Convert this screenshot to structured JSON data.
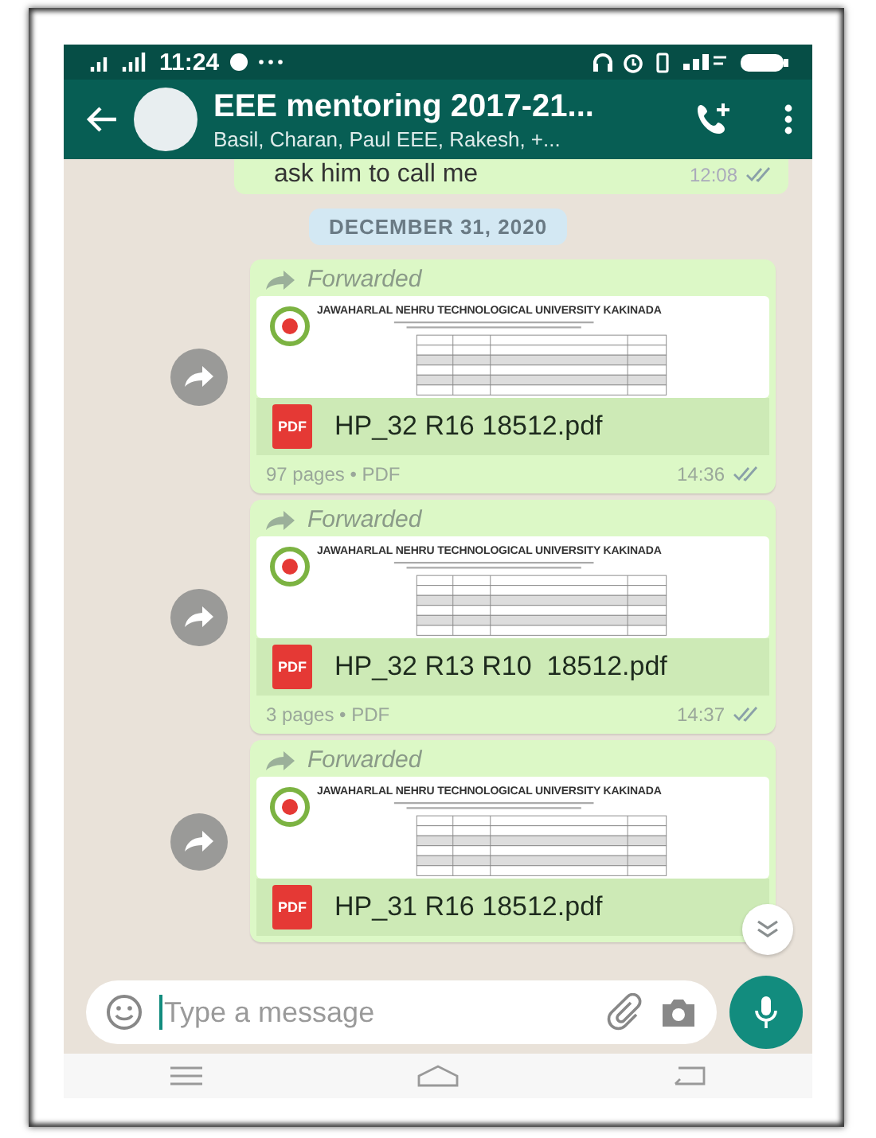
{
  "status_bar": {
    "time": "11:24"
  },
  "header": {
    "title": "EEE mentoring 2017-21...",
    "subtitle": "Basil, Charan, Paul EEE, Rakesh, +..."
  },
  "messages": [
    {
      "kind": "text",
      "text": "ask him to call me",
      "time": "12:08"
    },
    {
      "kind": "date",
      "text": "DECEMBER 31, 2020"
    },
    {
      "kind": "document",
      "forwarded": "Forwarded",
      "preview_title": "JAWAHARLAL NEHRU TECHNOLOGICAL UNIVERSITY KAKINADA",
      "badge": "PDF",
      "file_name": "HP_32 R16 18512.pdf",
      "details": "97 pages • PDF",
      "time": "14:36"
    },
    {
      "kind": "document",
      "forwarded": "Forwarded",
      "preview_title": "JAWAHARLAL NEHRU TECHNOLOGICAL UNIVERSITY KAKINADA",
      "badge": "PDF",
      "file_name": "HP_32 R13 R10  18512.pdf",
      "details": "3 pages • PDF",
      "time": "14:37"
    },
    {
      "kind": "document",
      "forwarded": "Forwarded",
      "preview_title": "JAWAHARLAL NEHRU TECHNOLOGICAL UNIVERSITY KAKINADA",
      "badge": "PDF",
      "file_name": "HP_31 R16 18512.pdf"
    }
  ],
  "composer": {
    "placeholder": "Type a message"
  }
}
